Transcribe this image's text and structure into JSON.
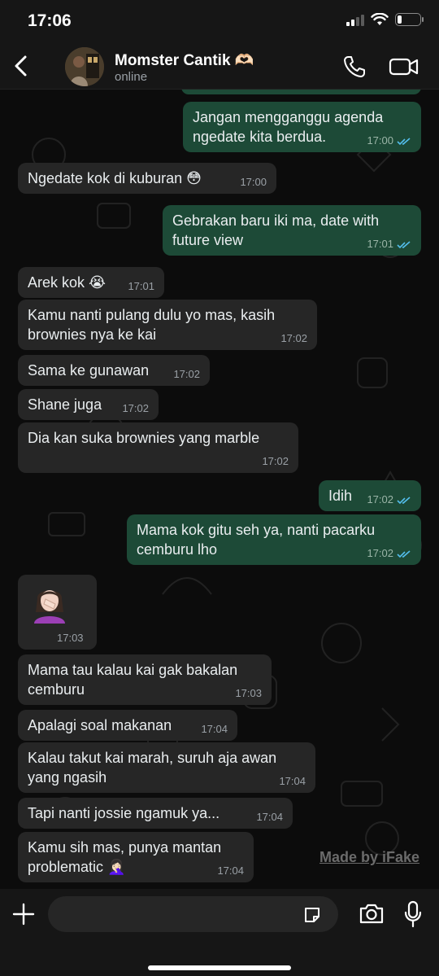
{
  "status_bar": {
    "time": "17:06",
    "battery_level": 0.2
  },
  "header": {
    "contact_name": "Momster Cantik 🫶🏻",
    "contact_status": "online",
    "back_icon": "chevron-left-icon",
    "call_icon": "phone-icon",
    "video_icon": "video-camera-icon"
  },
  "messages": [
    {
      "text": "Jangan mengganggu agenda ngedate kita berdua.",
      "time": "17:00",
      "dir": "out",
      "read": true
    },
    {
      "text": "Ngedate kok di kuburan 😳",
      "time": "17:00",
      "dir": "in"
    },
    {
      "text": "Gebrakan baru iki ma, date with future view",
      "time": "17:01",
      "dir": "out",
      "read": true
    },
    {
      "text": "Arek kok 😭",
      "time": "17:01",
      "dir": "in"
    },
    {
      "text": "Kamu nanti pulang dulu yo mas, kasih brownies nya ke kai",
      "time": "17:02",
      "dir": "in"
    },
    {
      "text": "Sama ke gunawan",
      "time": "17:02",
      "dir": "in"
    },
    {
      "text": "Shane juga",
      "time": "17:02",
      "dir": "in"
    },
    {
      "text": "Dia kan suka brownies yang marble",
      "time": "17:02",
      "dir": "in"
    },
    {
      "text": "Idih",
      "time": "17:02",
      "dir": "out",
      "read": true
    },
    {
      "text": "Mama kok gitu seh ya, nanti pacarku cemburu lho",
      "time": "17:02",
      "dir": "out",
      "read": true
    },
    {
      "text": "",
      "time": "17:03",
      "dir": "in",
      "emoji": "woman-facepalming"
    },
    {
      "text": "Mama tau kalau kai gak bakalan cemburu",
      "time": "17:03",
      "dir": "in"
    },
    {
      "text": "Apalagi soal makanan",
      "time": "17:04",
      "dir": "in"
    },
    {
      "text": "Kalau takut kai marah, suruh aja awan yang ngasih",
      "time": "17:04",
      "dir": "in"
    },
    {
      "text": "Tapi nanti jossie ngamuk ya...",
      "time": "17:04",
      "dir": "in"
    },
    {
      "text": "Kamu sih mas, punya mantan problematic 🤦🏻‍♀️",
      "time": "17:04",
      "dir": "in"
    }
  ],
  "watermark": "Made by iFake",
  "input": {
    "placeholder": "",
    "plus_icon": "plus-icon",
    "sticker_icon": "sticker-icon",
    "camera_icon": "camera-icon",
    "mic_icon": "microphone-icon"
  },
  "colors": {
    "outgoing_bubble": "#1d4a37",
    "incoming_bubble": "#262626",
    "read_ticks": "#53bdeb"
  }
}
